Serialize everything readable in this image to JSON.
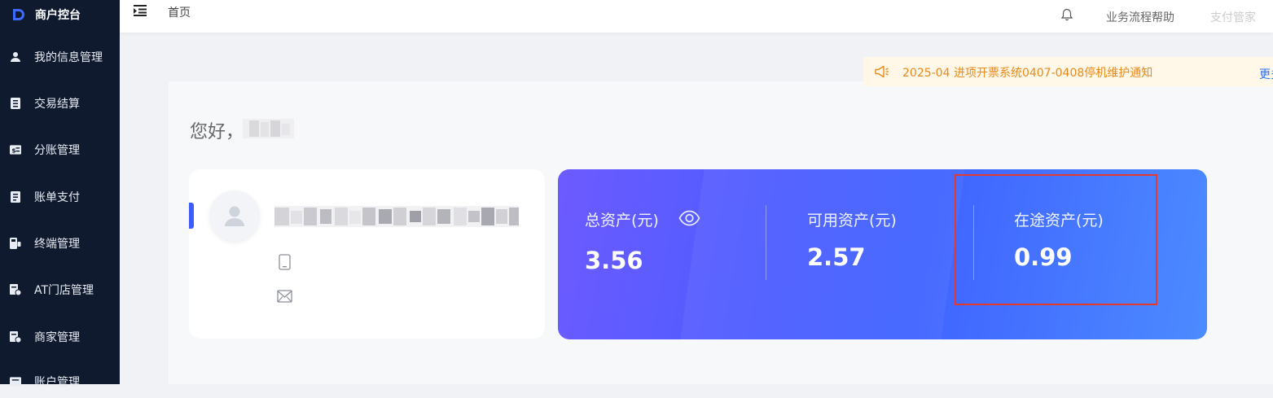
{
  "app": {
    "title": "商户控台",
    "logo_icon": "brand-d-logo"
  },
  "sidebar": {
    "items": [
      {
        "label": "我的信息管理",
        "icon": "user-icon"
      },
      {
        "label": "交易结算",
        "icon": "ledger-icon"
      },
      {
        "label": "分账管理",
        "icon": "split-icon"
      },
      {
        "label": "账单支付",
        "icon": "bill-icon"
      },
      {
        "label": "终端管理",
        "icon": "terminal-icon"
      },
      {
        "label": "AT门店管理",
        "icon": "store-icon"
      },
      {
        "label": "商家管理",
        "icon": "merchant-icon"
      },
      {
        "label": "账户管理",
        "icon": "account-icon"
      }
    ]
  },
  "header": {
    "breadcrumb": "首页",
    "help_link": "业务流程帮助",
    "butler_link": "支付管家"
  },
  "notice": {
    "text": "2025-04  进项开票系统0407-0408停机维护通知",
    "more": "更多"
  },
  "greeting": {
    "text": "您好，"
  },
  "assets": {
    "total": {
      "label": "总资产(元)",
      "value": "3.56"
    },
    "available": {
      "label": "可用资产(元)",
      "value": "2.57"
    },
    "in_transit": {
      "label": "在途资产(元)",
      "value": "0.99"
    }
  },
  "colors": {
    "sidebar_bg": "#0f1a2e",
    "accent": "#3d5cff",
    "notice_text": "#e98a1a",
    "highlight_border": "#e23a2f"
  }
}
